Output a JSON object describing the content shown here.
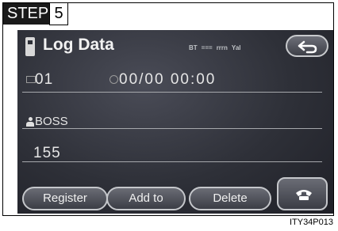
{
  "step": {
    "label": "STEP",
    "number": "5"
  },
  "header": {
    "title": "Log Data",
    "signal_indicators": [
      "BT",
      "===",
      "rrrn",
      "Yal"
    ]
  },
  "record": {
    "id": "01",
    "datetime": "00/00 00:00",
    "name": "BOSS",
    "number": "155"
  },
  "buttons": {
    "register": "Register",
    "add_to": "Add to",
    "delete": "Delete"
  },
  "icons": {
    "title": "memory-card-icon",
    "back": "back-arrow-icon",
    "id": "memory-slot-icon",
    "clock": "clock-icon",
    "person": "person-icon",
    "phone": "phone-handset-icon"
  },
  "colors": {
    "screen_bg": "#2e3038",
    "text": "#e6e6e6",
    "button_border": "#c5c7cb"
  },
  "footer": {
    "reference": "ITY34P013"
  }
}
